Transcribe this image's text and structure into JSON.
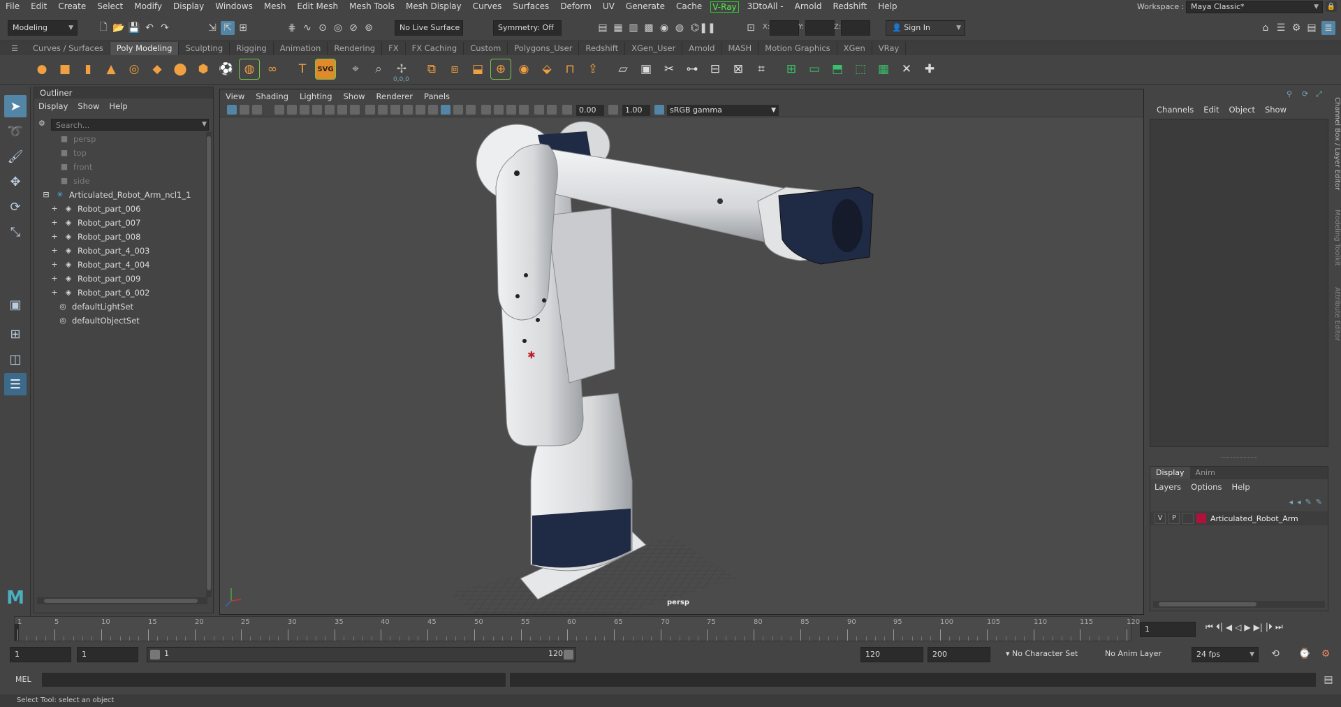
{
  "menubar": {
    "items": [
      "File",
      "Edit",
      "Create",
      "Select",
      "Modify",
      "Display",
      "Windows",
      "Mesh",
      "Edit Mesh",
      "Mesh Tools",
      "Mesh Display",
      "Curves",
      "Surfaces",
      "Deform",
      "UV",
      "Generate",
      "Cache"
    ],
    "vray": "V-Ray",
    "items2": [
      "3DtoAll -",
      "Arnold",
      "Redshift",
      "Help"
    ],
    "workspace_label": "Workspace :",
    "workspace_value": "Maya Classic*"
  },
  "statusline": {
    "mode": "Modeling",
    "live_surface": "No Live Surface",
    "symmetry": "Symmetry: Off",
    "x_label": "X:",
    "y_label": "Y:",
    "z_label": "Z:",
    "sign_in": "Sign In"
  },
  "shelf": {
    "tabs": [
      "Curves / Surfaces",
      "Poly Modeling",
      "Sculpting",
      "Rigging",
      "Animation",
      "Rendering",
      "FX",
      "FX Caching",
      "Custom",
      "Polygons_User",
      "Redshift",
      "XGen_User",
      "Arnold",
      "MASH",
      "Motion Graphics",
      "XGen",
      "VRay"
    ],
    "active_tab": 1,
    "icons": [
      "sphere",
      "cube",
      "cylinder",
      "cone",
      "torus",
      "plane",
      "disc",
      "platonic",
      "soccer",
      "pipe",
      "helix",
      "text",
      "svg",
      "camera",
      "measure",
      "pivot",
      "combine",
      "separate",
      "extract",
      "boolean",
      "smooth",
      "bevel",
      "bridge",
      "extrude",
      "append",
      "fill-hole",
      "multicut",
      "connect",
      "insert-loop",
      "offset-loop",
      "quad-draw",
      "uv-editor",
      "planar",
      "automatic",
      "unfold",
      "layout",
      "cut",
      "sew"
    ],
    "text_icon": "T",
    "svg_icon": "SVG",
    "pivot_label": "0,0,0"
  },
  "outliner": {
    "title": "Outliner",
    "menu": [
      "Display",
      "Show",
      "Help"
    ],
    "search_placeholder": "Search...",
    "cameras": [
      "persp",
      "top",
      "front",
      "side"
    ],
    "group": "Articulated_Robot_Arm_ncl1_1",
    "children": [
      "Robot_part_006",
      "Robot_part_007",
      "Robot_part_008",
      "Robot_part_4_003",
      "Robot_part_4_004",
      "Robot_part_009",
      "Robot_part_6_002"
    ],
    "sets": [
      "defaultLightSet",
      "defaultObjectSet"
    ]
  },
  "viewport": {
    "menu": [
      "View",
      "Shading",
      "Lighting",
      "Show",
      "Renderer",
      "Panels"
    ],
    "exposure": "0.00",
    "gamma": "1.00",
    "color_space": "sRGB gamma",
    "camera_label": "persp"
  },
  "channelbox": {
    "menu": [
      "Channels",
      "Edit",
      "Object",
      "Show"
    ]
  },
  "layers": {
    "tabs": [
      "Display",
      "Anim"
    ],
    "menu": [
      "Layers",
      "Options",
      "Help"
    ],
    "layer_v": "V",
    "layer_p": "P",
    "layer_name": "Articulated_Robot_Arm",
    "layer_color": "#b0103a"
  },
  "side_tabs": [
    "Channel Box / Layer Editor",
    "Modeling Toolkit",
    "Attribute Editor"
  ],
  "timeline": {
    "ticks": [
      1,
      5,
      10,
      15,
      20,
      25,
      30,
      35,
      40,
      45,
      50,
      55,
      60,
      65,
      70,
      75,
      80,
      85,
      90,
      95,
      100,
      105,
      110,
      115,
      120
    ],
    "current_frame": "1"
  },
  "range": {
    "start": "1",
    "playback_start": "1",
    "slider_start": "1",
    "slider_end": "120",
    "playback_end": "120",
    "end": "200",
    "character_set": "No Character Set",
    "anim_layer": "No Anim Layer",
    "fps": "24 fps"
  },
  "cmd": {
    "label": "MEL"
  },
  "helpline": {
    "text": "Select Tool: select an object"
  },
  "colors": {
    "accent": "#5285a6",
    "robot_body": "#d9dbdd",
    "robot_band": "#1f2a44"
  }
}
